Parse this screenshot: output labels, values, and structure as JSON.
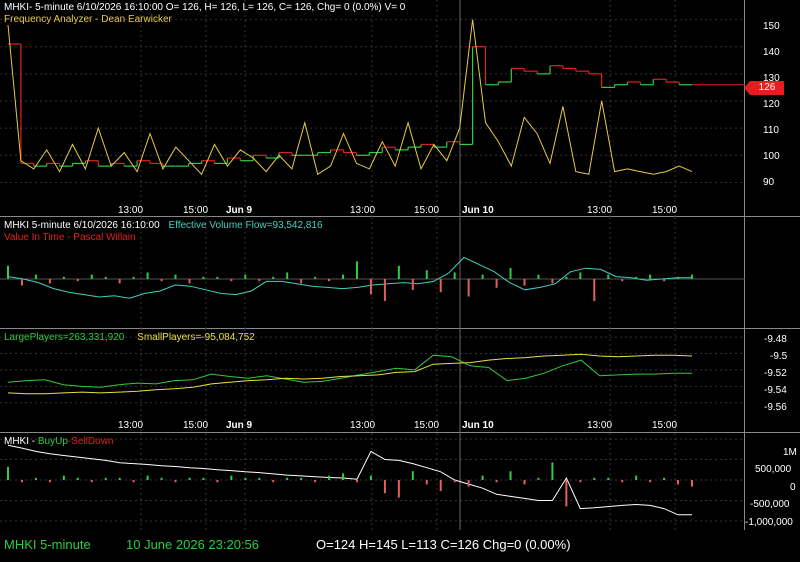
{
  "colors": {
    "up": "#2ecc40",
    "down": "#e02020",
    "freq": "#e8c84a",
    "cyan": "#40d0c0",
    "green": "#2ecc40",
    "yellow": "#e8e040",
    "white": "#ffffff"
  },
  "pane1": {
    "title": "MHKI- 5-minute 6/10/2026 16:10:00 O= 126, H= 126, L= 126, C= 126, Chg= 0 (0.0%) V= 0",
    "indicator": "Frequency Analyzer - Dean Earwicker",
    "y_labels": [
      "150",
      "140",
      "130",
      "120",
      "110",
      "100",
      "90"
    ],
    "price_tag": "126"
  },
  "time_axis": {
    "labels": [
      "13:00",
      "15:00",
      "Jun 9",
      "13:00",
      "15:00",
      "Jun 10",
      "13:00",
      "15:00"
    ]
  },
  "pane2": {
    "title": "MHKI 5-minute  6/10/2026 16:10:00",
    "indicator": "Effective Volume Flow=93,542,816",
    "sub": "Value In Time - Pascal Willain"
  },
  "pane3": {
    "large": "LargePlayers=263,331,920",
    "small": "SmallPlayers=-95,084,752",
    "y_labels": [
      "-9.48",
      "-9.5",
      "-9.52",
      "-9.54",
      "-9.56"
    ]
  },
  "pane4": {
    "title": "MHKI - ",
    "buy": "BuyUp",
    "sep": "-",
    "sell": "SellDown",
    "y_labels": [
      "1M",
      "500,000",
      "0",
      "-500,000",
      "-1,000,000"
    ]
  },
  "footer": {
    "symbol": "MHKI  5-minute",
    "date": "10 June 2026 23:20:56",
    "ohlc": "O=124  H=145  L=113  C=126  Chg=0 (0.00%)"
  },
  "chart_data": [
    {
      "type": "line",
      "title": "MHKI- 5-minute 6/10/2026 16:10:00 O= 126, H= 126, L= 126, C= 126, Chg= 0 (0.0%) V= 0",
      "ylim": [
        85,
        155
      ],
      "series": [
        {
          "name": "MHKI",
          "values": [
            141,
            97,
            96,
            97,
            96,
            97,
            98,
            96,
            97,
            96,
            98,
            97,
            96,
            96,
            97,
            98,
            97,
            99,
            98,
            100,
            99,
            101,
            100,
            100,
            101,
            102,
            101,
            100,
            101,
            103,
            102,
            103,
            104,
            103,
            105,
            104,
            140,
            126,
            127,
            132,
            131,
            130,
            133,
            132,
            131,
            130,
            125,
            126,
            127,
            126,
            128,
            127,
            126,
            126
          ]
        },
        {
          "name": "Frequency Analyzer - Dean Earwicker",
          "values": [
            148,
            98,
            95,
            102,
            94,
            104,
            95,
            110,
            96,
            101,
            94,
            108,
            95,
            103,
            98,
            93,
            104,
            96,
            102,
            99,
            94,
            100,
            95,
            112,
            93,
            96,
            108,
            97,
            95,
            105,
            96,
            112,
            95,
            104,
            98,
            110,
            150,
            112,
            105,
            96,
            114,
            108,
            97,
            118,
            94,
            93,
            120,
            94,
            95,
            94,
            93,
            94,
            96,
            94
          ]
        }
      ]
    },
    {
      "type": "line",
      "title": "MHKI 5-minute  6/10/2026 16:10:00",
      "series": [
        {
          "name": "Effective Volume Flow",
          "values": [
            0.2,
            0.0,
            -0.3,
            -0.8,
            -1.1,
            -1.3,
            -1.5,
            -1.4,
            -1.6,
            -1.2,
            -1.0,
            -0.5,
            -0.6,
            -0.9,
            -1.2,
            -1.3,
            -1.0,
            -0.2,
            -0.2,
            -0.4,
            -0.6,
            -0.7,
            -0.8,
            -0.7,
            -0.5,
            -0.4,
            -0.3,
            -0.4,
            -0.2,
            0.5,
            1.8,
            1.2,
            0.6,
            -0.3,
            -0.9,
            -0.7,
            -0.4,
            0.6,
            0.9,
            0.8,
            0.2,
            0.1,
            -0.1,
            0.0,
            0.1,
            0.1
          ]
        }
      ]
    },
    {
      "type": "line",
      "ylim": [
        -9.57,
        -9.475
      ],
      "series": [
        {
          "name": "LargePlayers",
          "values": [
            -9.535,
            -9.533,
            -9.532,
            -9.538,
            -9.54,
            -9.541,
            -9.538,
            -9.536,
            -9.537,
            -9.533,
            -9.532,
            -9.525,
            -9.528,
            -9.53,
            -9.527,
            -9.531,
            -9.535,
            -9.534,
            -9.53,
            -9.526,
            -9.522,
            -9.518,
            -9.52,
            -9.502,
            -9.504,
            -9.515,
            -9.517,
            -9.533,
            -9.53,
            -9.524,
            -9.515,
            -9.508,
            -9.527,
            -9.526,
            -9.525,
            -9.525,
            -9.524,
            -9.524
          ]
        },
        {
          "name": "SmallPlayers",
          "values": [
            -9.548,
            -9.549,
            -9.549,
            -9.548,
            -9.547,
            -9.548,
            -9.547,
            -9.546,
            -9.544,
            -9.543,
            -9.541,
            -9.537,
            -9.535,
            -9.533,
            -9.532,
            -9.53,
            -9.531,
            -9.53,
            -9.528,
            -9.527,
            -9.526,
            -9.523,
            -9.522,
            -9.513,
            -9.512,
            -9.511,
            -9.508,
            -9.506,
            -9.505,
            -9.503,
            -9.502,
            -9.501,
            -9.503,
            -9.504,
            -9.503,
            -9.502,
            -9.502,
            -9.503
          ]
        }
      ]
    },
    {
      "type": "bar",
      "title": "MHKI - BuyUp-SellDown",
      "ylim": [
        -1100000,
        1100000
      ],
      "series": [
        {
          "name": "BuyUp-SellDown",
          "values": [
            850000,
            780000,
            700000,
            640000,
            600000,
            560000,
            520000,
            480000,
            420000,
            400000,
            380000,
            350000,
            330000,
            300000,
            280000,
            250000,
            230000,
            200000,
            180000,
            150000,
            120000,
            100000,
            80000,
            60000,
            50000,
            20000,
            700000,
            500000,
            480000,
            400000,
            300000,
            200000,
            0,
            -100000,
            -200000,
            -350000,
            -400000,
            -450000,
            -500000,
            -500000,
            50000,
            -700000,
            -680000,
            -650000,
            -620000,
            -600000,
            -620000,
            -700000,
            -850000,
            -850000
          ]
        }
      ]
    }
  ]
}
